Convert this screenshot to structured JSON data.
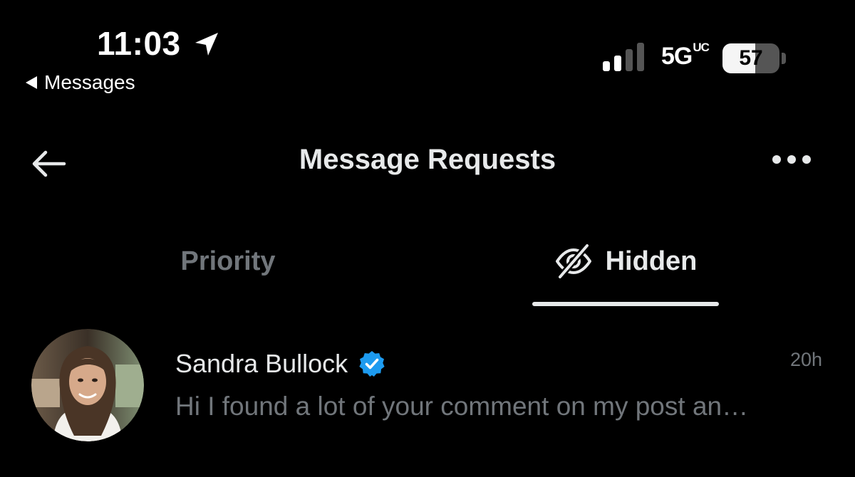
{
  "status_bar": {
    "time": "11:03",
    "back_app_label": "Messages",
    "network_main": "5G",
    "network_super": "UC",
    "battery_percent": "57",
    "battery_level": 0.57,
    "signal_bars_active": 2,
    "signal_bars_total": 4
  },
  "header": {
    "title": "Message Requests"
  },
  "tabs": [
    {
      "label": "Priority",
      "active": false
    },
    {
      "label": "Hidden",
      "active": true,
      "icon": "eye-off-icon"
    }
  ],
  "conversations": [
    {
      "name": "Sandra Bullock",
      "verified": true,
      "time": "20h",
      "preview": "Hi I found a lot of your comment on my post an…"
    }
  ],
  "colors": {
    "background": "#000000",
    "primary_text": "#e7e9ea",
    "secondary_text": "#71767b",
    "verified_blue": "#1d9bf0"
  }
}
